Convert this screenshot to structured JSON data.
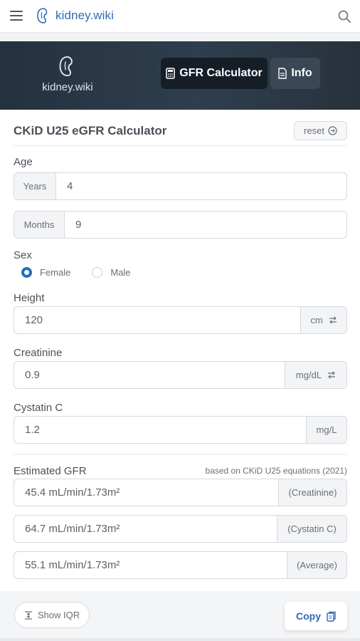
{
  "topbar": {
    "brand": "kidney.wiki",
    "menu_icon": "hamburger-menu-icon",
    "search_icon": "search-icon"
  },
  "hero": {
    "logo_text": "kidney.wiki",
    "tabs": [
      {
        "label": "GFR Calculator",
        "icon": "calculator-icon",
        "active": true
      },
      {
        "label": "Info",
        "icon": "document-icon",
        "active": false
      }
    ]
  },
  "calculator": {
    "title": "CKiD U25 eGFR Calculator",
    "reset_label": "reset",
    "age": {
      "label": "Age",
      "years_addon": "Years",
      "years_value": "4",
      "months_addon": "Months",
      "months_value": "9"
    },
    "sex": {
      "label": "Sex",
      "options": [
        "Female",
        "Male"
      ],
      "selected": "Female"
    },
    "height": {
      "label": "Height",
      "value": "120",
      "unit": "cm"
    },
    "creatinine": {
      "label": "Creatinine",
      "value": "0.9",
      "unit": "mg/dL"
    },
    "cystatin": {
      "label": "Cystatin C",
      "value": "1.2",
      "unit": "mg/L"
    },
    "results": {
      "label": "Estimated GFR",
      "note": "based on CKiD U25 equations (2021)",
      "rows": [
        {
          "value": "45.4 mL/min/1.73m²",
          "tag": "(Creatinine)"
        },
        {
          "value": "64.7 mL/min/1.73m²",
          "tag": "(Cystatin C)"
        },
        {
          "value": "55.1 mL/min/1.73m²",
          "tag": "(Average)"
        }
      ]
    },
    "show_iqr_label": "Show IQR",
    "copy_label": "Copy"
  },
  "colors": {
    "accent": "#1f6fc2",
    "brand": "#2f6bb4",
    "hero_dark": "#24313f"
  }
}
